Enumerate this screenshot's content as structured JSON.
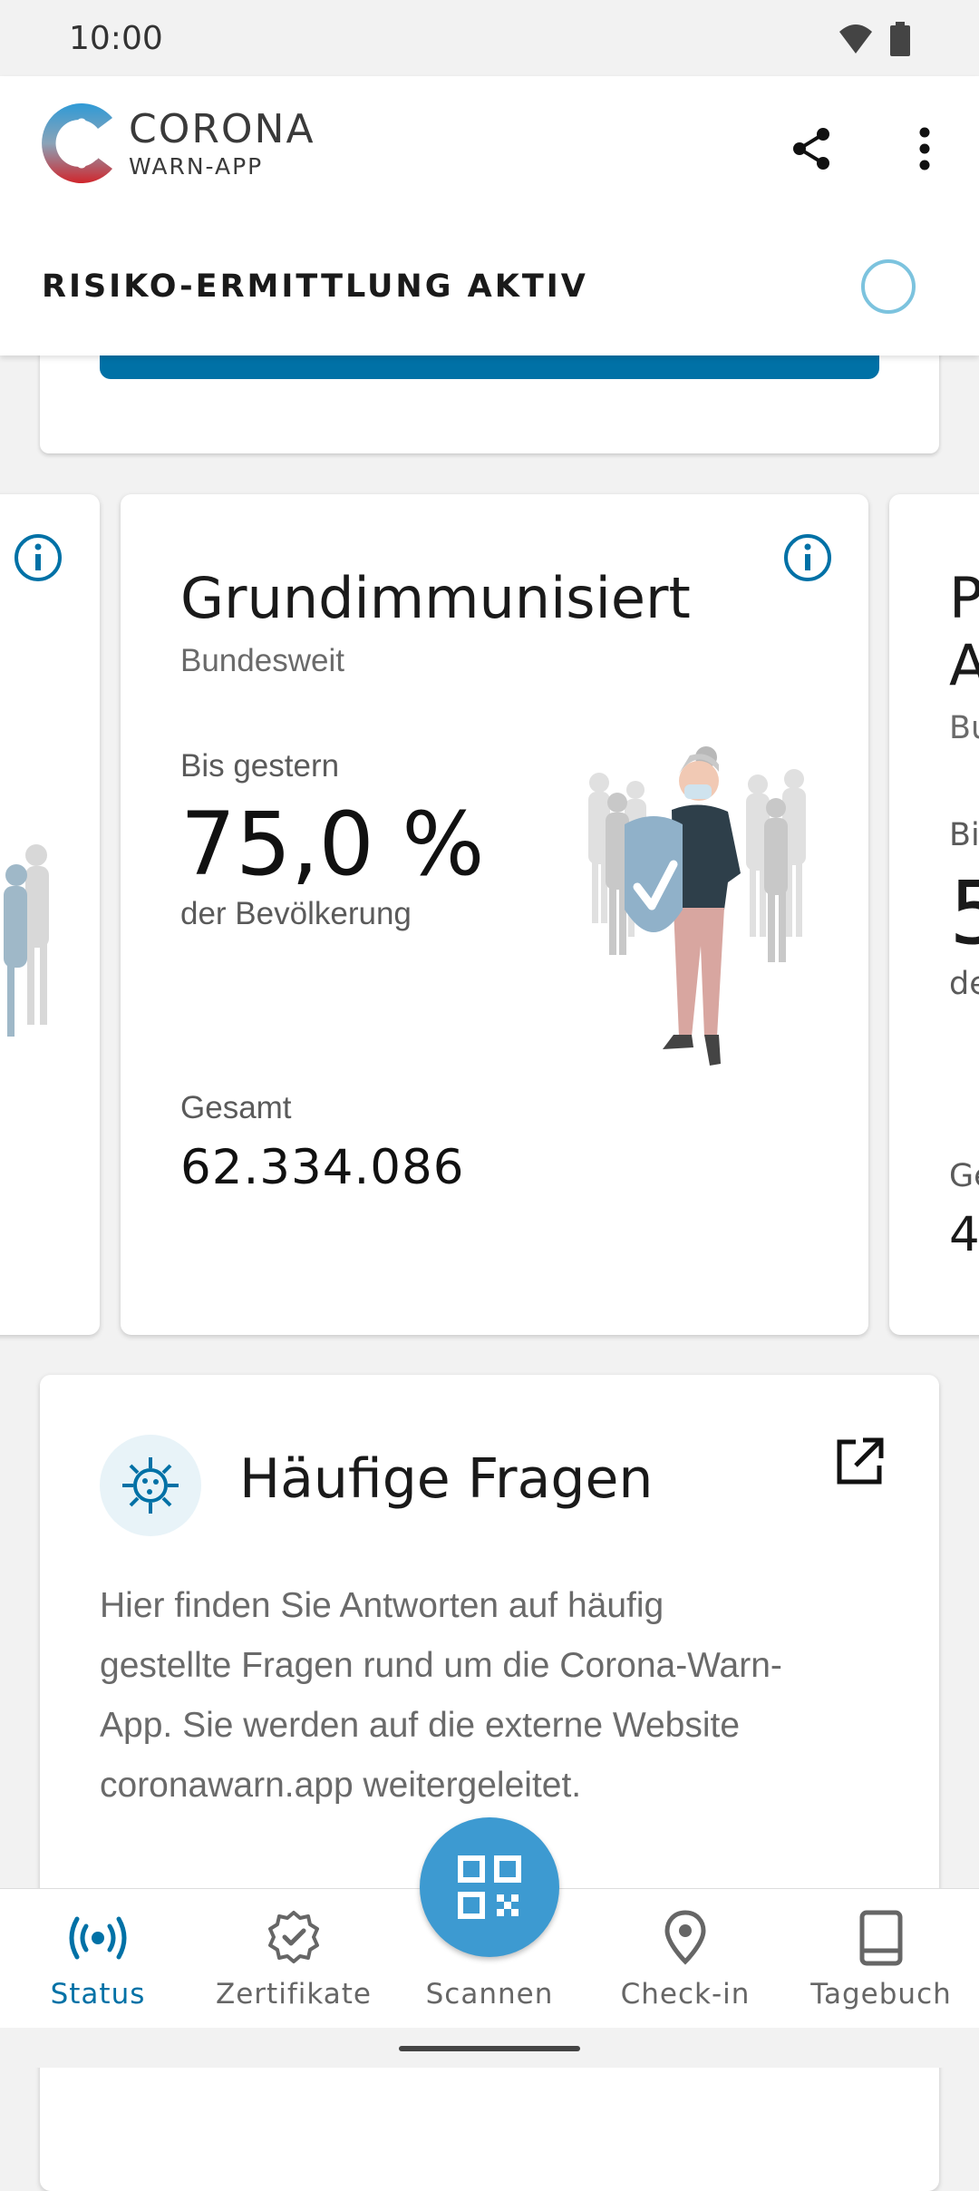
{
  "status_bar": {
    "time": "10:00"
  },
  "app_bar": {
    "logo_line1": "CORONA",
    "logo_line2": "WARN-APP",
    "risk_label": "RISIKO-ERMITTLUNG AKTIV"
  },
  "stat_cards": {
    "main": {
      "title": "Grundimmunisiert",
      "subtitle": "Bundesweit",
      "period_label": "Bis gestern",
      "percentage": "75,0 %",
      "percentage_caption": "der Bevölkerung",
      "total_label": "Gesamt",
      "total_value": "62.334.086"
    },
    "right_peek": {
      "title_l1": "P",
      "title_l2": "A",
      "subtitle": "Bu",
      "period_label": "Bi",
      "value": "5",
      "caption": "de",
      "total_label": "Ge",
      "total_value": "4"
    }
  },
  "faq": {
    "title": "Häufige Fragen",
    "body": "Hier finden Sie Antworten auf häufig gestellte Fragen rund um die Corona-Warn-App. Sie werden auf die externe Website coronawarn.app weitergeleitet."
  },
  "bottom_nav": {
    "items": [
      {
        "label": "Status",
        "icon": "broadcast-icon",
        "active": true
      },
      {
        "label": "Zertifikate",
        "icon": "certificate-badge-icon",
        "active": false
      },
      {
        "label": "Scannen",
        "icon": "qr-code-icon",
        "active": false
      },
      {
        "label": "Check-in",
        "icon": "location-pin-icon",
        "active": false
      },
      {
        "label": "Tagebuch",
        "icon": "book-icon",
        "active": false
      }
    ]
  },
  "colors": {
    "accent": "#0071a6",
    "fab": "#3d9ad1",
    "risk_ring": "#7cc3de"
  }
}
